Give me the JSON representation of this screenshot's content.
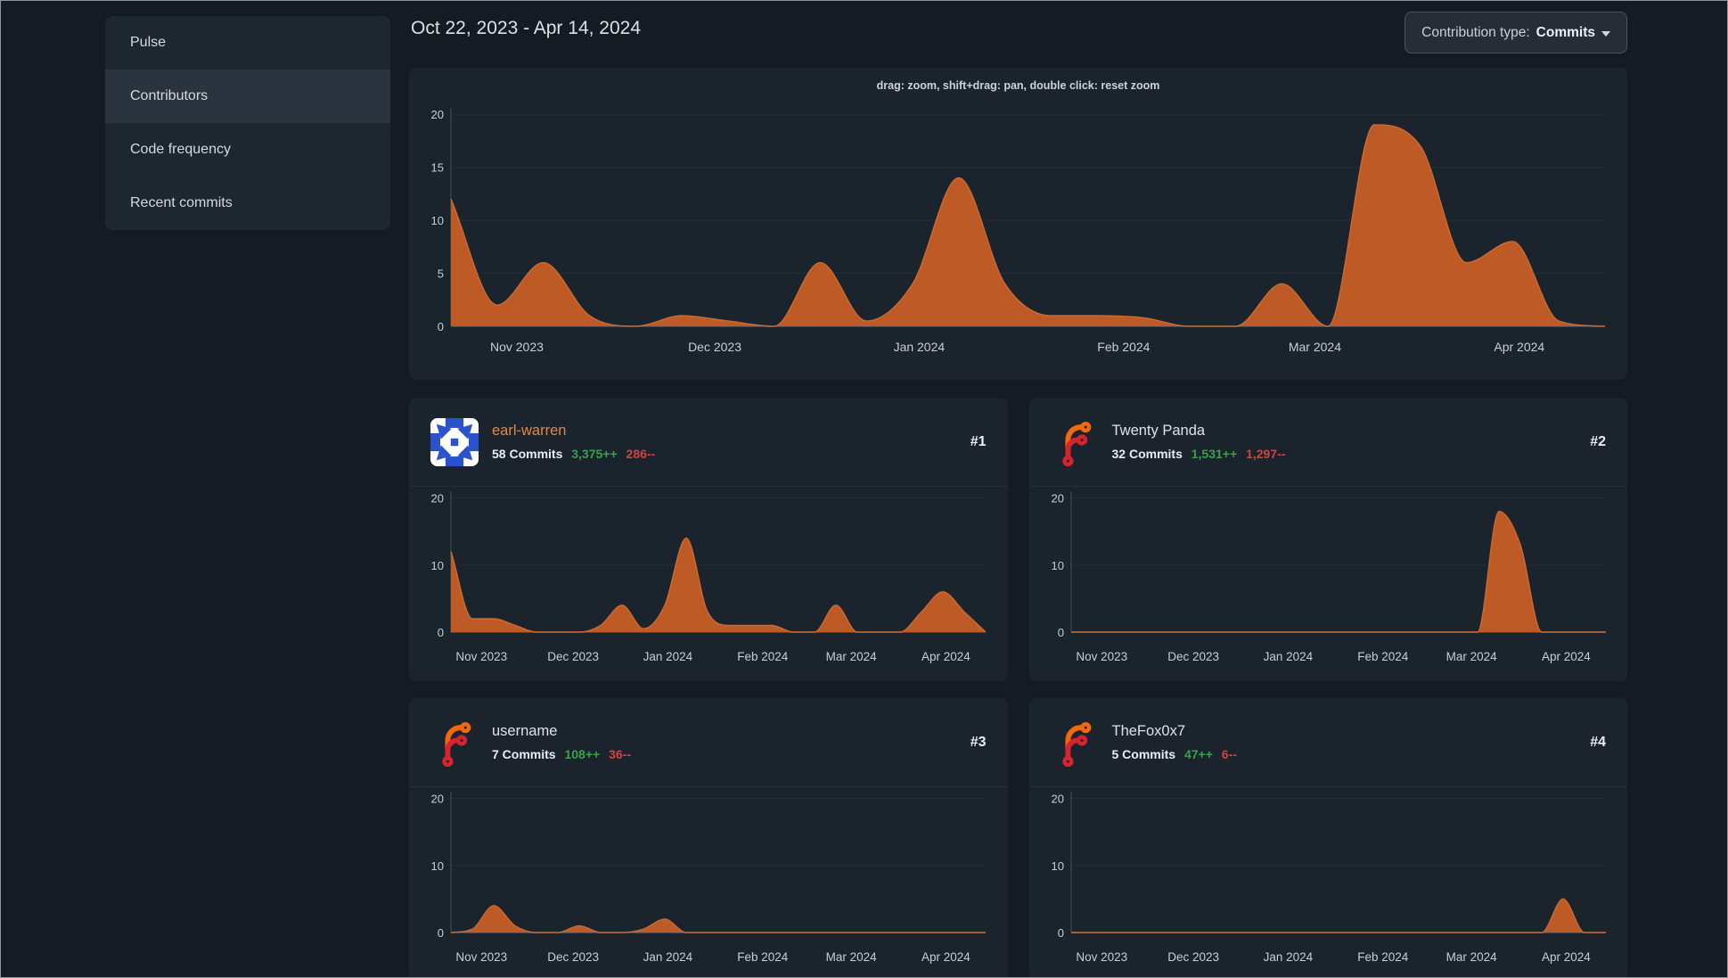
{
  "sidebar": {
    "items": [
      {
        "label": "Pulse",
        "active": false
      },
      {
        "label": "Contributors",
        "active": true
      },
      {
        "label": "Code frequency",
        "active": false
      },
      {
        "label": "Recent commits",
        "active": false
      }
    ]
  },
  "header": {
    "date_range": "Oct 22, 2023 - Apr 14, 2024",
    "contribution_type": {
      "label": "Contribution type:",
      "value": "Commits"
    }
  },
  "main_chart": {
    "hint": "drag: zoom, shift+drag: pan, double click: reset zoom"
  },
  "contributors": [
    {
      "rank": "#1",
      "name": "earl-warren",
      "commits": "58 Commits",
      "additions": "3,375++",
      "deletions": "286--",
      "avatar": "identicon"
    },
    {
      "rank": "#2",
      "name": "Twenty Panda",
      "commits": "32 Commits",
      "additions": "1,531++",
      "deletions": "1,297--",
      "avatar": "forgejo-logo"
    },
    {
      "rank": "#3",
      "name": "username",
      "commits": "7 Commits",
      "additions": "108++",
      "deletions": "36--",
      "avatar": "forgejo-logo"
    },
    {
      "rank": "#4",
      "name": "TheFox0x7",
      "commits": "5 Commits",
      "additions": "47++",
      "deletions": "6--",
      "avatar": "forgejo-logo"
    }
  ],
  "colors": {
    "area_fill": "#bd5a25",
    "area_stroke": "#c96a30",
    "link_orange": "#e0884a",
    "additions_green": "#3aa04c",
    "deletions_red": "#d04343",
    "identicon_blue": "#2a52cc",
    "logo_orange": "#f1680d",
    "logo_red": "#d32430"
  },
  "chart_data": [
    {
      "type": "area",
      "name": "all-contributions-weekly-commits",
      "y_ticks": [
        0,
        5,
        10,
        15,
        20
      ],
      "ylim": [
        0,
        20.6
      ],
      "grid": true,
      "legend": "none",
      "x_tick_labels": [
        "Nov 2023",
        "Dec 2023",
        "Jan 2024",
        "Feb 2024",
        "Mar 2024",
        "Apr 2024"
      ],
      "x_tick_fractions": [
        0.0571,
        0.2286,
        0.4057,
        0.5829,
        0.7486,
        0.9257
      ],
      "values": [
        12,
        2,
        6,
        1,
        0,
        1,
        0.5,
        0,
        6,
        0.5,
        4,
        14,
        4,
        1,
        1,
        0.8,
        0,
        0,
        4,
        0,
        19,
        17,
        6,
        8,
        0.5,
        0
      ]
    },
    {
      "type": "area",
      "name": "earl-warren-weekly-commits",
      "y_ticks": [
        0,
        10,
        20
      ],
      "ylim": [
        0,
        21
      ],
      "grid": true,
      "legend": "none",
      "x_tick_labels": [
        "Nov 2023",
        "Dec 2023",
        "Jan 2024",
        "Feb 2024",
        "Mar 2024",
        "Apr 2024"
      ],
      "x_tick_fractions": [
        0.0571,
        0.2286,
        0.4057,
        0.5829,
        0.7486,
        0.9257
      ],
      "values": [
        12,
        2,
        2,
        1,
        0,
        0,
        0,
        1,
        4,
        0.5,
        4,
        14,
        3,
        1,
        1,
        1,
        0,
        0,
        4,
        0,
        0,
        0,
        3,
        6,
        3,
        0
      ]
    },
    {
      "type": "area",
      "name": "twenty-panda-weekly-commits",
      "y_ticks": [
        0,
        10,
        20
      ],
      "ylim": [
        0,
        21
      ],
      "grid": true,
      "legend": "none",
      "x_tick_labels": [
        "Nov 2023",
        "Dec 2023",
        "Jan 2024",
        "Feb 2024",
        "Mar 2024",
        "Apr 2024"
      ],
      "x_tick_fractions": [
        0.0571,
        0.2286,
        0.4057,
        0.5829,
        0.7486,
        0.9257
      ],
      "values": [
        0,
        0,
        0,
        0,
        0,
        0,
        0,
        0,
        0,
        0,
        0,
        0,
        0,
        0,
        0,
        0,
        0,
        0,
        0,
        0,
        18,
        13,
        0,
        0,
        0,
        0
      ]
    },
    {
      "type": "area",
      "name": "username-weekly-commits",
      "y_ticks": [
        0,
        10,
        20
      ],
      "ylim": [
        0,
        21
      ],
      "grid": true,
      "legend": "none",
      "x_tick_labels": [
        "Nov 2023",
        "Dec 2023",
        "Jan 2024",
        "Feb 2024",
        "Mar 2024",
        "Apr 2024"
      ],
      "x_tick_fractions": [
        0.0571,
        0.2286,
        0.4057,
        0.5829,
        0.7486,
        0.9257
      ],
      "values": [
        0,
        0.5,
        4,
        1,
        0,
        0,
        1,
        0,
        0,
        0.5,
        2,
        0,
        0,
        0,
        0,
        0,
        0,
        0,
        0,
        0,
        0,
        0,
        0,
        0,
        0,
        0
      ]
    },
    {
      "type": "area",
      "name": "thefox0x7-weekly-commits",
      "y_ticks": [
        0,
        10,
        20
      ],
      "ylim": [
        0,
        21
      ],
      "grid": true,
      "legend": "none",
      "x_tick_labels": [
        "Nov 2023",
        "Dec 2023",
        "Jan 2024",
        "Feb 2024",
        "Mar 2024",
        "Apr 2024"
      ],
      "x_tick_fractions": [
        0.0571,
        0.2286,
        0.4057,
        0.5829,
        0.7486,
        0.9257
      ],
      "values": [
        0,
        0,
        0,
        0,
        0,
        0,
        0,
        0,
        0,
        0,
        0,
        0,
        0,
        0,
        0,
        0,
        0,
        0,
        0,
        0,
        0,
        0,
        0,
        5,
        0,
        0
      ]
    }
  ]
}
